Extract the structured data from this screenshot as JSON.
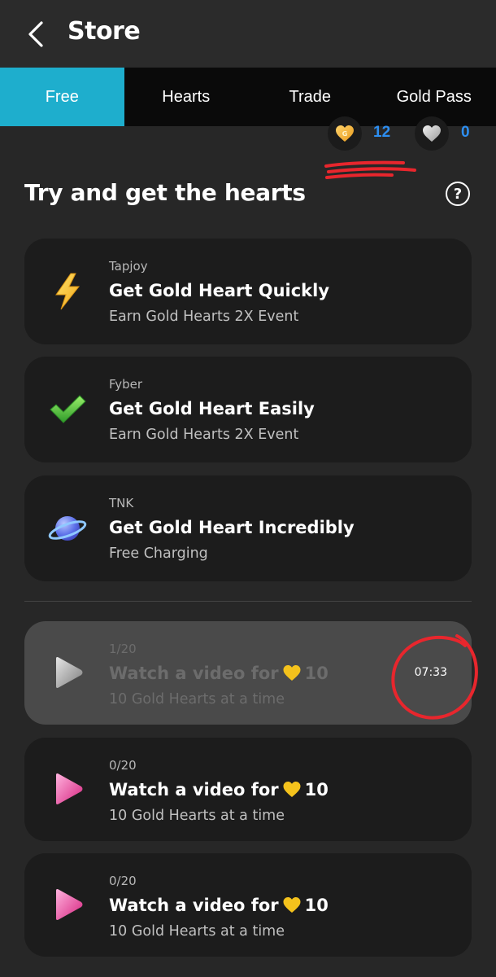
{
  "header": {
    "title": "Store"
  },
  "tabs": [
    {
      "label": "Free",
      "active": true
    },
    {
      "label": "Hearts",
      "active": false
    },
    {
      "label": "Trade",
      "active": false
    },
    {
      "label": "Gold Pass",
      "active": false
    }
  ],
  "balance": {
    "gold_count": "12",
    "silver_count": "0"
  },
  "section": {
    "title": "Try and get the hearts",
    "help_symbol": "?"
  },
  "offers": [
    {
      "provider": "Tapjoy",
      "title": "Get Gold Heart Quickly",
      "subtitle": "Earn Gold Hearts 2X Event",
      "icon": "lightning-icon"
    },
    {
      "provider": "Fyber",
      "title": "Get Gold Heart Easily",
      "subtitle": "Earn Gold Hearts 2X Event",
      "icon": "check-icon"
    },
    {
      "provider": "TNK",
      "title": "Get Gold Heart Incredibly",
      "subtitle": "Free Charging",
      "icon": "planet-icon"
    }
  ],
  "videos": [
    {
      "progress": "1/20",
      "title_prefix": "Watch a video for",
      "title_amount": "10",
      "subtitle": "10 Gold Hearts at a time",
      "timer": "07:33",
      "disabled": true
    },
    {
      "progress": "0/20",
      "title_prefix": "Watch a video for",
      "title_amount": "10",
      "subtitle": "10 Gold Hearts at a time",
      "disabled": false
    },
    {
      "progress": "0/20",
      "title_prefix": "Watch a video for",
      "title_amount": "10",
      "subtitle": "10 Gold Hearts at a time",
      "disabled": false
    }
  ],
  "colors": {
    "accent": "#1eaecd",
    "count": "#2d8ef0",
    "annotation": "#e8262d"
  }
}
